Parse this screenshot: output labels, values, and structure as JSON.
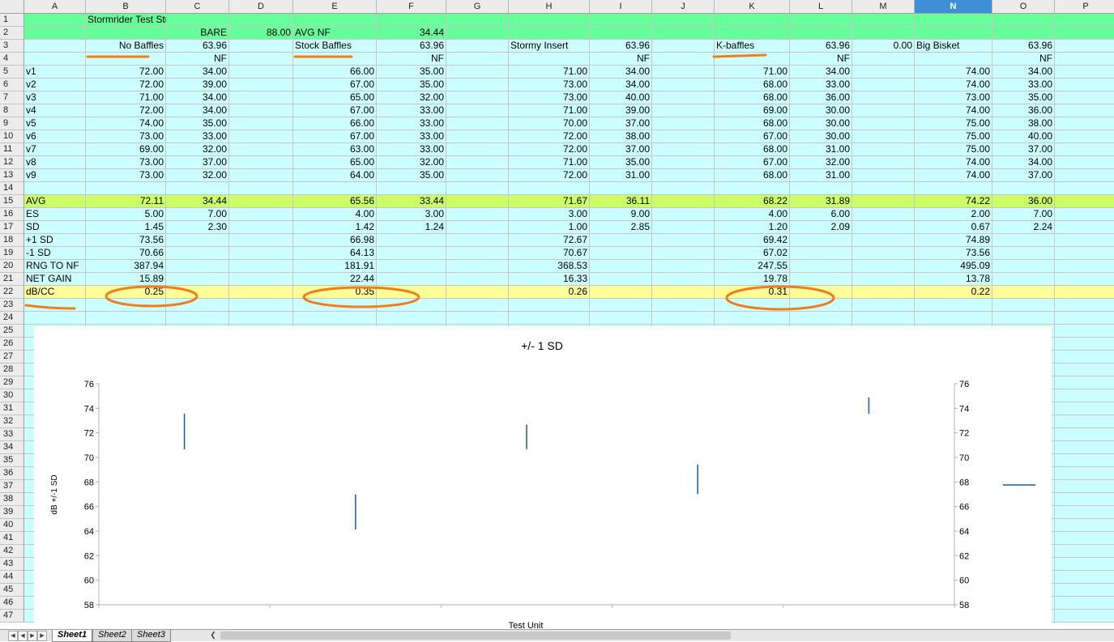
{
  "sheet": {
    "columns": [
      "A",
      "B",
      "C",
      "D",
      "E",
      "F",
      "G",
      "H",
      "I",
      "J",
      "K",
      "L",
      "M",
      "N",
      "O",
      "P"
    ],
    "selected_column": "N",
    "rows": {
      "1": {
        "B": "Stormrider Test Study"
      },
      "2": {
        "C": "BARE",
        "D": "88.00",
        "E": "AVG NF",
        "F": "34.44"
      },
      "3": {
        "B": "No Baffles",
        "C": "63.96",
        "E": "Stock Baffles",
        "F": "63.96",
        "H": "Stormy Insert",
        "I": "63.96",
        "K": "K-baffles",
        "L": "63.96",
        "M": "0.00",
        "N": "Big Bisket",
        "O": "63.96"
      },
      "4": {
        "C": "NF",
        "F": "NF",
        "I": "NF",
        "L": "NF",
        "O": "NF"
      },
      "5": {
        "A": "v1",
        "B": "72.00",
        "C": "34.00",
        "E": "66.00",
        "F": "35.00",
        "H": "71.00",
        "I": "34.00",
        "K": "71.00",
        "L": "34.00",
        "N": "74.00",
        "O": "34.00"
      },
      "6": {
        "A": "v2",
        "B": "72.00",
        "C": "39.00",
        "E": "67.00",
        "F": "35.00",
        "H": "73.00",
        "I": "34.00",
        "K": "68.00",
        "L": "33.00",
        "N": "74.00",
        "O": "33.00"
      },
      "7": {
        "A": "v3",
        "B": "71.00",
        "C": "34.00",
        "E": "65.00",
        "F": "32.00",
        "H": "73.00",
        "I": "40.00",
        "K": "68.00",
        "L": "36.00",
        "N": "73.00",
        "O": "35.00"
      },
      "8": {
        "A": "v4",
        "B": "72.00",
        "C": "34.00",
        "E": "67.00",
        "F": "33.00",
        "H": "71.00",
        "I": "39.00",
        "K": "69.00",
        "L": "30.00",
        "N": "74.00",
        "O": "36.00"
      },
      "9": {
        "A": "v5",
        "B": "74.00",
        "C": "35.00",
        "E": "66.00",
        "F": "33.00",
        "H": "70.00",
        "I": "37.00",
        "K": "68.00",
        "L": "30.00",
        "N": "75.00",
        "O": "38.00"
      },
      "10": {
        "A": "v6",
        "B": "73.00",
        "C": "33.00",
        "E": "67.00",
        "F": "33.00",
        "H": "72.00",
        "I": "38.00",
        "K": "67.00",
        "L": "30.00",
        "N": "75.00",
        "O": "40.00"
      },
      "11": {
        "A": "v7",
        "B": "69.00",
        "C": "32.00",
        "E": "63.00",
        "F": "33.00",
        "H": "72.00",
        "I": "37.00",
        "K": "68.00",
        "L": "31.00",
        "N": "75.00",
        "O": "37.00"
      },
      "12": {
        "A": "v8",
        "B": "73.00",
        "C": "37.00",
        "E": "65.00",
        "F": "32.00",
        "H": "71.00",
        "I": "35.00",
        "K": "67.00",
        "L": "32.00",
        "N": "74.00",
        "O": "34.00"
      },
      "13": {
        "A": "v9",
        "B": "73.00",
        "C": "32.00",
        "E": "64.00",
        "F": "35.00",
        "H": "72.00",
        "I": "31.00",
        "K": "68.00",
        "L": "31.00",
        "N": "74.00",
        "O": "37.00"
      },
      "14": {},
      "15": {
        "A": "AVG",
        "B": "72.11",
        "C": "34.44",
        "E": "65.56",
        "F": "33.44",
        "H": "71.67",
        "I": "36.11",
        "K": "68.22",
        "L": "31.89",
        "N": "74.22",
        "O": "36.00"
      },
      "16": {
        "A": "ES",
        "B": "5.00",
        "C": "7.00",
        "E": "4.00",
        "F": "3.00",
        "H": "3.00",
        "I": "9.00",
        "K": "4.00",
        "L": "6.00",
        "N": "2.00",
        "O": "7.00"
      },
      "17": {
        "A": "SD",
        "B": "1.45",
        "C": "2.30",
        "E": "1.42",
        "F": "1.24",
        "H": "1.00",
        "I": "2.85",
        "K": "1.20",
        "L": "2.09",
        "N": "0.67",
        "O": "2.24"
      },
      "18": {
        "A": "+1 SD",
        "B": "73.56",
        "E": "66.98",
        "H": "72.67",
        "K": "69.42",
        "N": "74.89"
      },
      "19": {
        "A": "-1 SD",
        "B": "70.66",
        "E": "64.13",
        "H": "70.67",
        "K": "67.02",
        "N": "73.56"
      },
      "20": {
        "A": "RNG TO NF",
        "B": "387.94",
        "E": "181.91",
        "H": "368.53",
        "K": "247.55",
        "N": "495.09"
      },
      "21": {
        "A": "NET GAIN",
        "B": "15.89",
        "E": "22.44",
        "H": "16.33",
        "K": "19.78",
        "N": "13.78"
      },
      "22": {
        "A": "dB/CC",
        "B": "0.25",
        "E": "0.35",
        "H": "0.26",
        "K": "0.31",
        "N": "0.22"
      },
      "23": {},
      "24": {},
      "25": {},
      "26": {},
      "27": {},
      "28": {},
      "29": {},
      "30": {},
      "31": {},
      "32": {},
      "33": {},
      "34": {},
      "35": {},
      "36": {},
      "37": {},
      "38": {},
      "39": {},
      "40": {},
      "41": {},
      "42": {},
      "43": {},
      "44": {},
      "45": {},
      "46": {},
      "47": {}
    },
    "colors": {
      "title_rows": "#66ff99",
      "data_bg": "#ccffff",
      "avg_row": "#ccff66",
      "dbcc_row": "#ffff99",
      "annotation": "#f07e1e",
      "selected_header": "#3f8fd6"
    }
  },
  "chart_data": {
    "type": "stock-highlow",
    "title": "+/- 1 SD",
    "xlabel": "Test Unit",
    "ylabel": "dB +/-1 SD",
    "ylim": [
      58,
      76
    ],
    "yticks": [
      58,
      60,
      62,
      64,
      66,
      68,
      70,
      72,
      74,
      76
    ],
    "secondary_y_axis": true,
    "grid": false,
    "legend": "right (series key line, no text)",
    "series_color": "#1f5b8c",
    "points": [
      {
        "high": 73.56,
        "low": 70.66
      },
      {
        "high": 66.98,
        "low": 64.13
      },
      {
        "high": 72.67,
        "low": 70.67
      },
      {
        "high": 69.42,
        "low": 67.02
      },
      {
        "high": 74.89,
        "low": 73.56
      }
    ]
  },
  "tabs": [
    {
      "label": "Sheet1",
      "active": true
    },
    {
      "label": "Sheet2",
      "active": false
    },
    {
      "label": "Sheet3",
      "active": false
    }
  ]
}
